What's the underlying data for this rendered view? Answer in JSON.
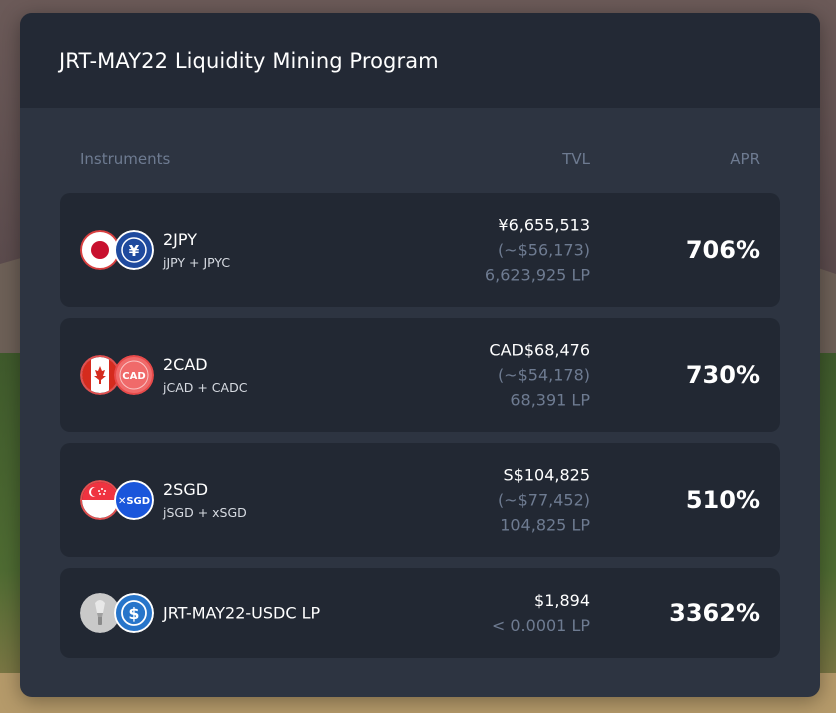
{
  "title": "JRT-MAY22 Liquidity Mining Program",
  "columns": {
    "instruments": "Instruments",
    "tvl": "TVL",
    "apr": "APR"
  },
  "rows": [
    {
      "name": "2JPY",
      "pair": "jJPY + JPYC",
      "tvl_native": "¥6,655,513",
      "tvl_usd": "(~$56,173)",
      "tvl_lp": "6,623,925 LP",
      "apr": "706%",
      "icons": [
        "japan-flag-icon",
        "jpyc-yen-icon"
      ]
    },
    {
      "name": "2CAD",
      "pair": "jCAD + CADC",
      "tvl_native": "CAD$68,476",
      "tvl_usd": "(~$54,178)",
      "tvl_lp": "68,391 LP",
      "apr": "730%",
      "icons": [
        "canada-flag-icon",
        "cadc-icon"
      ]
    },
    {
      "name": "2SGD",
      "pair": "jSGD + xSGD",
      "tvl_native": "S$104,825",
      "tvl_usd": "(~$77,452)",
      "tvl_lp": "104,825 LP",
      "apr": "510%",
      "icons": [
        "singapore-flag-icon",
        "xsgd-icon"
      ]
    },
    {
      "name": "JRT-MAY22-USDC LP",
      "tvl_native": "$1,894",
      "tvl_lp": "< 0.0001 LP",
      "apr": "3362%",
      "icons": [
        "jrt-torch-icon",
        "usdc-icon"
      ]
    }
  ],
  "colors": {
    "card_bg": "#2d3441",
    "header_bg": "#232935",
    "row_bg": "#222833",
    "muted_text": "#6e7b91",
    "yen_coin": "#1f4a9e",
    "cad_red": "#e84a4a",
    "usdc_blue": "#2775ca"
  }
}
